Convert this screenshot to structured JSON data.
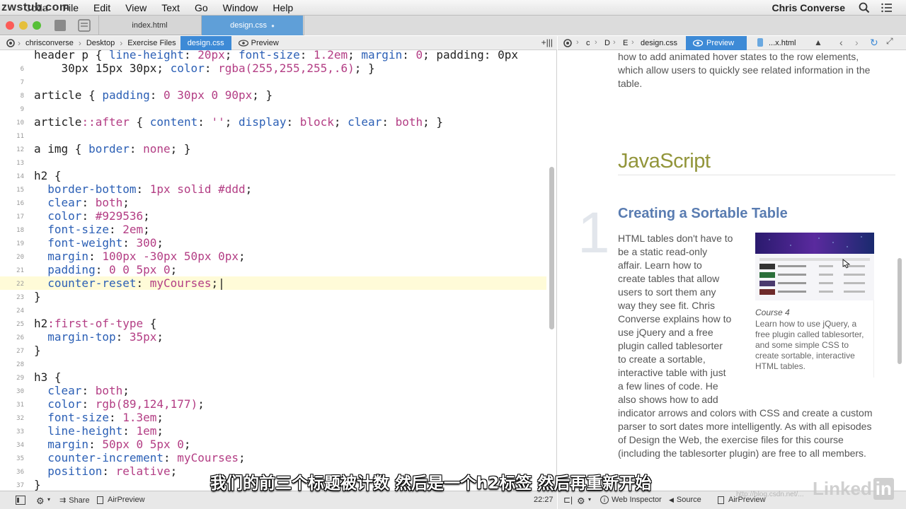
{
  "watermark": "zwstub.com",
  "menubar": {
    "items": [
      "Coda",
      "File",
      "Edit",
      "View",
      "Text",
      "Go",
      "Window",
      "Help"
    ],
    "user": "Chris Converse"
  },
  "tabs": [
    {
      "label": "index.html",
      "active": false
    },
    {
      "label": "design.css",
      "active": true
    }
  ],
  "breadcrumb": {
    "items": [
      "chrisconverse",
      "Desktop",
      "Exercise Files",
      "design.css",
      "Preview"
    ]
  },
  "preview_bar": {
    "items": [
      "c",
      "D",
      "E",
      "design.css",
      "Preview",
      "...x.html"
    ]
  },
  "editor": {
    "current_line": 22,
    "lines": [
      {
        "n": "",
        "text": "header p { line-height: 20px; font-size: 1.2em; margin: 0; padding: 0px"
      },
      {
        "n": "6",
        "text": "    30px 15px 30px; color: rgba(255,255,255,.6); }"
      },
      {
        "n": "7",
        "text": ""
      },
      {
        "n": "8",
        "text": "article { padding: 0 30px 0 90px; }"
      },
      {
        "n": "9",
        "text": ""
      },
      {
        "n": "10",
        "text": "article::after { content: ''; display: block; clear: both; }"
      },
      {
        "n": "11",
        "text": ""
      },
      {
        "n": "12",
        "text": "a img { border: none; }"
      },
      {
        "n": "13",
        "text": ""
      },
      {
        "n": "14",
        "text": "h2 {"
      },
      {
        "n": "15",
        "text": "  border-bottom: 1px solid #ddd;"
      },
      {
        "n": "16",
        "text": "  clear: both;"
      },
      {
        "n": "17",
        "text": "  color: #929536;"
      },
      {
        "n": "18",
        "text": "  font-size: 2em;"
      },
      {
        "n": "19",
        "text": "  font-weight: 300;"
      },
      {
        "n": "20",
        "text": "  margin: 100px -30px 50px 0px;"
      },
      {
        "n": "21",
        "text": "  padding: 0 0 5px 0;"
      },
      {
        "n": "22",
        "text": "  counter-reset: myCourses;|"
      },
      {
        "n": "23",
        "text": "}"
      },
      {
        "n": "24",
        "text": ""
      },
      {
        "n": "25",
        "text": "h2:first-of-type {"
      },
      {
        "n": "26",
        "text": "  margin-top: 35px;"
      },
      {
        "n": "27",
        "text": "}"
      },
      {
        "n": "28",
        "text": ""
      },
      {
        "n": "29",
        "text": "h3 {"
      },
      {
        "n": "30",
        "text": "  clear: both;"
      },
      {
        "n": "31",
        "text": "  color: rgb(89,124,177);"
      },
      {
        "n": "32",
        "text": "  font-size: 1.3em;"
      },
      {
        "n": "33",
        "text": "  line-height: 1em;"
      },
      {
        "n": "34",
        "text": "  margin: 50px 0 5px 0;"
      },
      {
        "n": "35",
        "text": "  counter-increment: myCourses;"
      },
      {
        "n": "36",
        "text": "  position: relative;"
      },
      {
        "n": "37",
        "text": "}"
      }
    ]
  },
  "preview": {
    "intro_lines": [
      "how to add animated hover states to the row elements,",
      "which allow users to quickly see related information in the",
      "table."
    ],
    "section_title": "JavaScript",
    "course_number": "1",
    "course_title": "Creating a Sortable Table",
    "body_lines_narrow": [
      "HTML tables don't have to",
      "be a static read-only",
      "affair. Learn how to",
      "create tables that allow",
      "users to sort them any",
      "way they see fit. Chris",
      "Converse explains how to",
      "use jQuery and a free",
      "plugin called tablesorter",
      "to create a sortable,",
      "interactive table with just",
      "a few lines of code. He",
      "also shows how to add"
    ],
    "body_lines_wide": [
      "indicator arrows and colors with CSS and create a custom",
      "parser to sort dates more intelligently. As with all episodes",
      "of Design the Web, the exercise files for this course",
      "(including the tablesorter plugin) are free to all members."
    ],
    "figure": {
      "caption_title": "Course 4",
      "caption_text": "Learn how to use jQuery, a free plugin called tablesorter, and some simple CSS to create sortable, interactive HTML tables."
    }
  },
  "status_left": {
    "share": "Share",
    "airpreview": "AirPreview",
    "position": "22:27"
  },
  "status_right": {
    "web_inspector": "Web Inspector",
    "source": "Source",
    "airpreview": "AirPreview"
  },
  "subtitle": "我们的前三个标题被计数  然后是一个h2标签  然后再重新开始",
  "logo": {
    "text": "Linked",
    "in": "in"
  },
  "watermark_url": "http://blog.csdn.net/..."
}
